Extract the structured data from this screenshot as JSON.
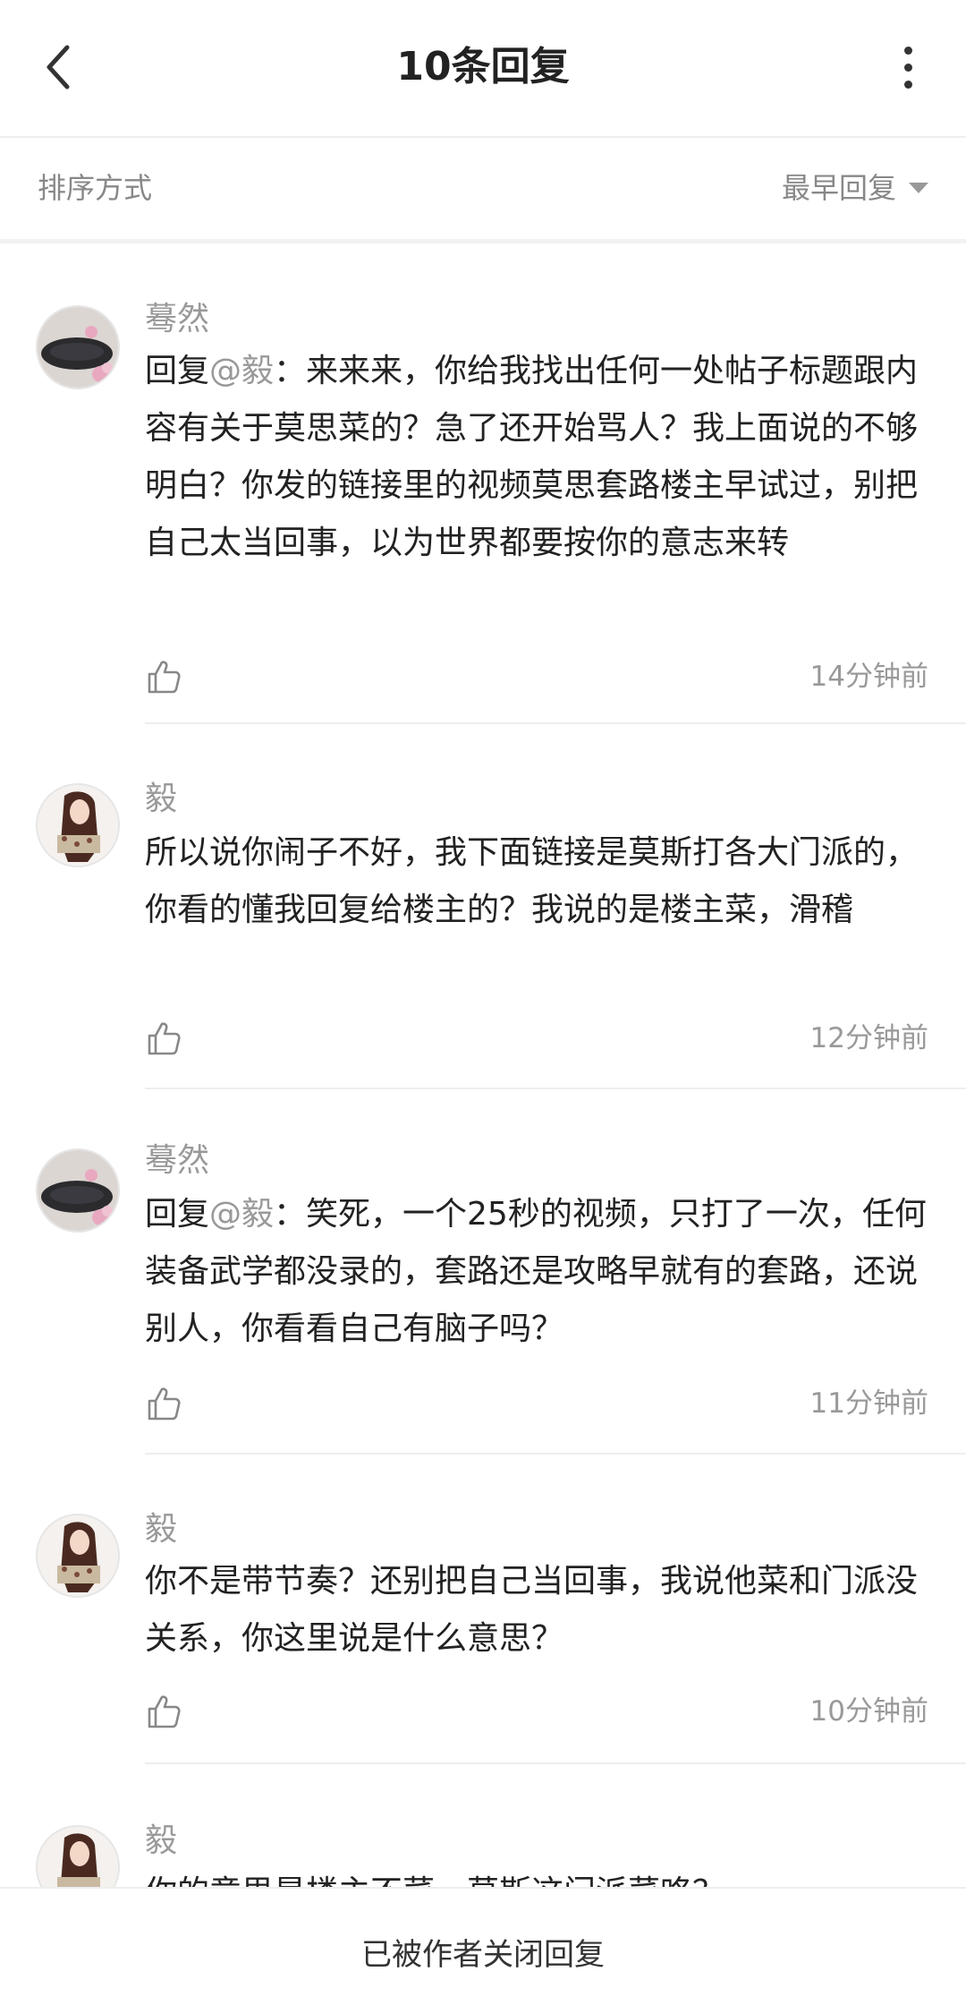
{
  "header": {
    "title": "10条回复",
    "back_icon": "chevron-left-icon",
    "more_icon": "more-vertical-icon"
  },
  "sort": {
    "label": "排序方式",
    "selected": "最早回复"
  },
  "comments": [
    {
      "username": "蓦然",
      "reply_prefix": "回复",
      "mention": "@毅",
      "text": "：来来来，你给我找出任何一处帖子标题跟内容有关于莫思菜的？急了还开始骂人？我上面说的不够明白？你发的链接里的视频莫思套路楼主早试过，别把自己太当回事，以为世界都要按你的意志来转",
      "time": "14分钟前"
    },
    {
      "username": "毅",
      "text": "所以说你闹子不好，我下面链接是莫斯打各大门派的，你看的懂我回复给楼主的？我说的是楼主菜，滑稽",
      "time": "12分钟前"
    },
    {
      "username": "蓦然",
      "reply_prefix": "回复",
      "mention": "@毅",
      "text": "：笑死，一个25秒的视频，只打了一次，任何装备武学都没录的，套路还是攻略早就有的套路，还说别人，你看看自己有脑子吗？",
      "time": "11分钟前"
    },
    {
      "username": "毅",
      "text": "你不是带节奏？还别把自己当回事，我说他菜和门派没关系，你这里说是什么意思？",
      "time": "10分钟前"
    },
    {
      "username": "毅",
      "text": "你的意思是楼主不菜，莫斯这门派菜咯？"
    }
  ],
  "footer": {
    "text": "已被作者关闭回复"
  }
}
